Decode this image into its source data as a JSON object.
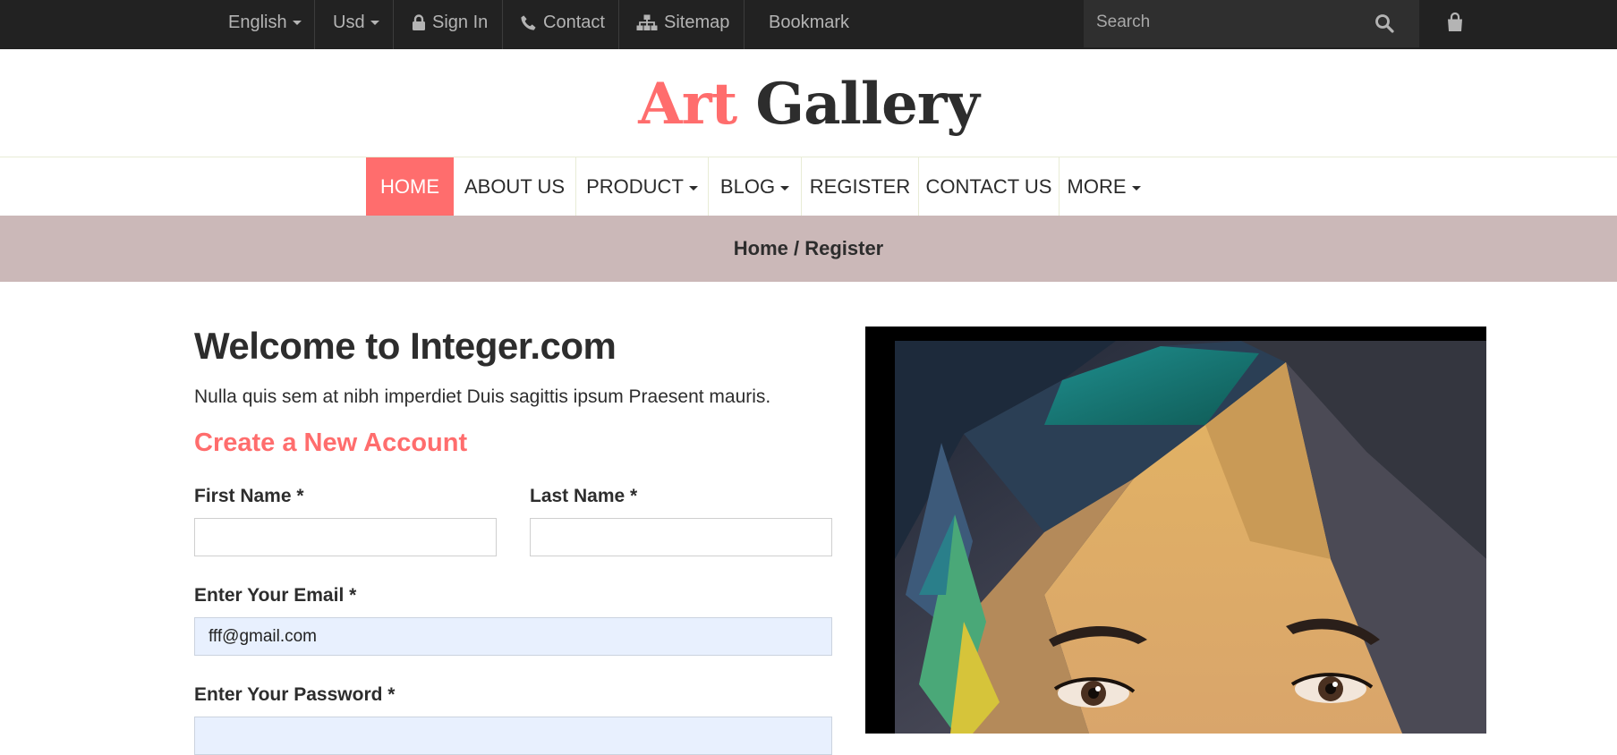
{
  "topbar": {
    "language": "English",
    "currency": "Usd",
    "signin": "Sign In",
    "contact": "Contact",
    "sitemap": "Sitemap",
    "bookmark": "Bookmark",
    "search_placeholder": "Search"
  },
  "logo": {
    "part1": "Art",
    "part2": "Gallery"
  },
  "nav": {
    "home": "HOME",
    "about": "ABOUT US",
    "product": "PRODUCT",
    "blog": "BLOG",
    "register": "REGISTER",
    "contact": "CONTACT US",
    "more": "MORE"
  },
  "breadcrumb": "Home / Register",
  "form": {
    "heading": "Welcome to Integer.com",
    "intro": "Nulla quis sem at nibh imperdiet Duis sagittis ipsum Praesent mauris.",
    "subheading": "Create a New Account",
    "first_name_label": "First Name *",
    "first_name_value": "",
    "last_name_label": "Last Name *",
    "last_name_value": "",
    "email_label": "Enter Your Email *",
    "email_value": "fff@gmail.com",
    "password_label": "Enter Your Password *",
    "password_value": ""
  },
  "colors": {
    "accent": "#ff6d6d",
    "topbar_bg": "#222222",
    "breadcrumb_bg": "#cbb8b8",
    "autofill_bg": "#e8f0fe"
  }
}
